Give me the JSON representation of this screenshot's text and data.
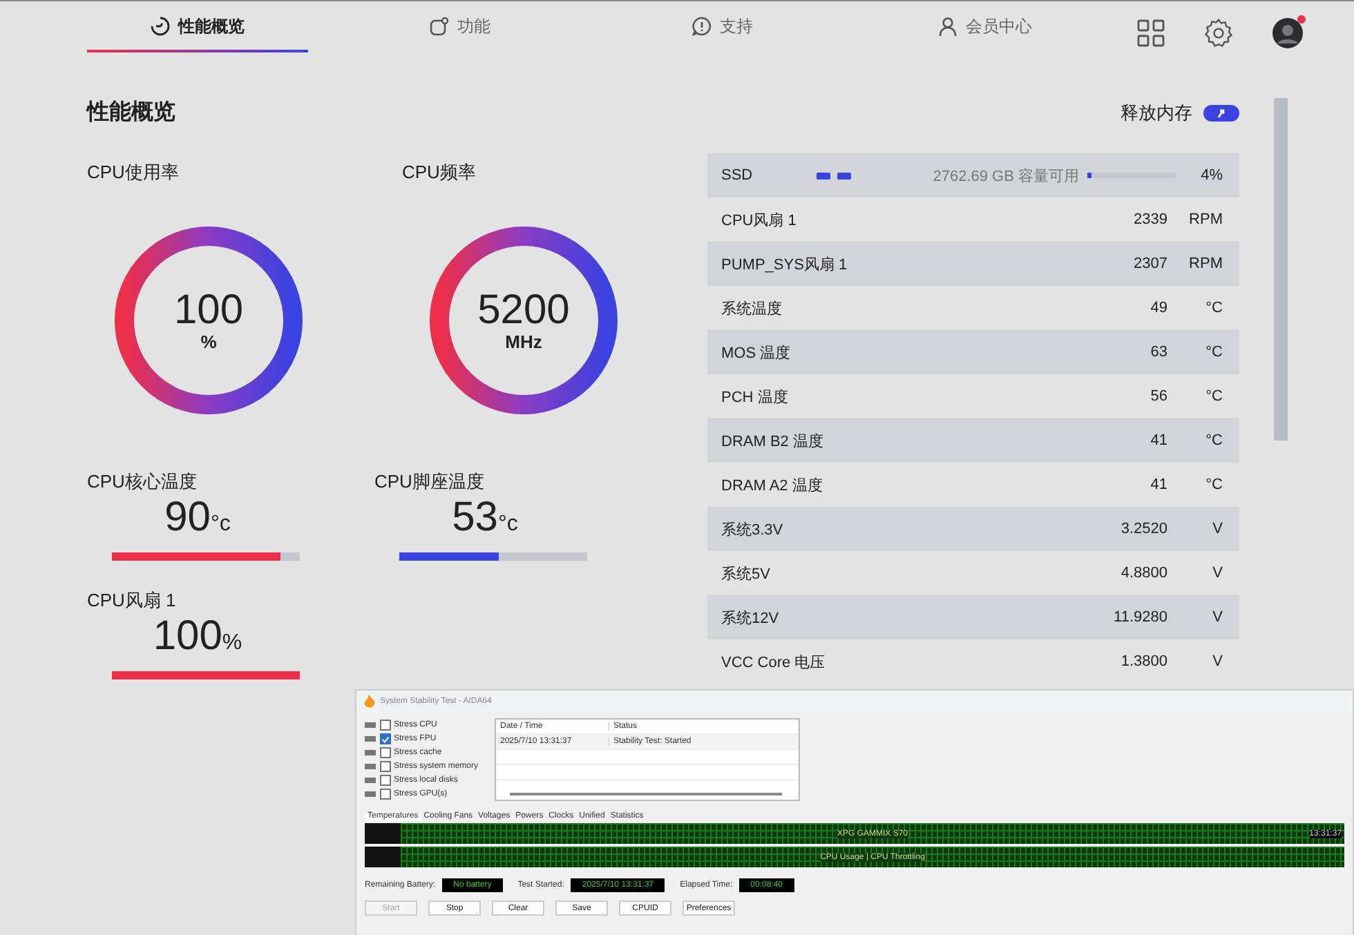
{
  "nav": {
    "tabs": [
      {
        "label": "性能概览",
        "kind": "gauge",
        "selected": true
      },
      {
        "label": "功能",
        "kind": "box",
        "selected": false
      },
      {
        "label": "支持",
        "kind": "alert",
        "selected": false
      },
      {
        "label": "会员中心",
        "kind": "user",
        "selected": false
      }
    ],
    "notification": true
  },
  "page_title": "性能概览",
  "release_memory": {
    "label": "释放内存",
    "on": true
  },
  "gauges": [
    {
      "label": "CPU使用率",
      "value": "100",
      "unit": "%",
      "level": 1
    },
    {
      "label": "CPU频率",
      "value": "5200",
      "unit": "MHz",
      "level": 1
    }
  ],
  "meters": [
    {
      "label": "CPU核心温度",
      "value": "90",
      "unit": "°c",
      "level": 0.9,
      "color": "#ee2f4a"
    },
    {
      "label": "CPU脚座温度",
      "value": "53",
      "unit": "°c",
      "level": 0.53,
      "color": "#3a42e0"
    },
    {
      "label": "CPU风扇 1",
      "value": "100",
      "unit": "%",
      "level": 1,
      "color": "#ee2f4a"
    }
  ],
  "sensors": [
    {
      "kind": "storage",
      "name": "SSD",
      "free": "2762.69 GB 容量可用",
      "level": 0.04,
      "reading": "4%"
    },
    {
      "kind": "reading",
      "name": "CPU风扇 1",
      "value": "2339",
      "unit": "RPM"
    },
    {
      "kind": "reading",
      "name": "PUMP_SYS风扇 1",
      "value": "2307",
      "unit": "RPM"
    },
    {
      "kind": "reading",
      "name": "系统温度",
      "value": "49",
      "unit": "°C"
    },
    {
      "kind": "reading",
      "name": "MOS 温度",
      "value": "63",
      "unit": "°C"
    },
    {
      "kind": "reading",
      "name": "PCH 温度",
      "value": "56",
      "unit": "°C"
    },
    {
      "kind": "reading",
      "name": "DRAM B2 温度",
      "value": "41",
      "unit": "°C"
    },
    {
      "kind": "reading",
      "name": "DRAM A2 温度",
      "value": "41",
      "unit": "°C"
    },
    {
      "kind": "reading",
      "name": "系统3.3V",
      "value": "3.2520",
      "unit": "V"
    },
    {
      "kind": "reading",
      "name": "系统5V",
      "value": "4.8800",
      "unit": "V"
    },
    {
      "kind": "reading",
      "name": "系统12V",
      "value": "11.9280",
      "unit": "V"
    },
    {
      "kind": "reading",
      "name": "VCC Core 电压",
      "value": "1.3800",
      "unit": "V"
    }
  ],
  "aida_window": {
    "title": "System Stability Test - AIDA64",
    "stress_options": [
      {
        "label": "Stress CPU",
        "checked": false
      },
      {
        "label": "Stress FPU",
        "checked": true
      },
      {
        "label": "Stress cache",
        "checked": false
      },
      {
        "label": "Stress system memory",
        "checked": false
      },
      {
        "label": "Stress local disks",
        "checked": false
      },
      {
        "label": "Stress GPU(s)",
        "checked": false
      }
    ],
    "log": {
      "columns": [
        "Date / Time",
        "Status"
      ],
      "rows": [
        [
          "2025/7/10 13:31:37",
          "Stability Test: Started"
        ]
      ]
    },
    "tabs": [
      {
        "label": "Temperatures",
        "selected": true
      },
      {
        "label": "Cooling Fans",
        "selected": false
      },
      {
        "label": "Voltages",
        "selected": false
      },
      {
        "label": "Powers",
        "selected": false
      },
      {
        "label": "Clocks",
        "selected": false
      },
      {
        "label": "Unified",
        "selected": false
      },
      {
        "label": "Statistics",
        "selected": false
      }
    ],
    "graphs": [
      {
        "legend": "XPG GAMMIX S70",
        "time": "13:31:37"
      },
      {
        "legend": "CPU Usage | CPU Throttling"
      }
    ],
    "status": [
      {
        "label": "Remaining Battery:",
        "value": "No battery"
      },
      {
        "label": "Test Started:",
        "value": "2025/7/10 13:31:37"
      },
      {
        "label": "Elapsed Time:",
        "value": "00:08:40"
      }
    ],
    "buttons": [
      {
        "label": "Start",
        "disabled": true
      },
      {
        "label": "Stop",
        "disabled": false
      },
      {
        "label": "Clear",
        "disabled": false
      },
      {
        "label": "Save",
        "disabled": false
      },
      {
        "label": "CPUID",
        "disabled": false
      },
      {
        "label": "Preferences",
        "disabled": false
      }
    ]
  }
}
